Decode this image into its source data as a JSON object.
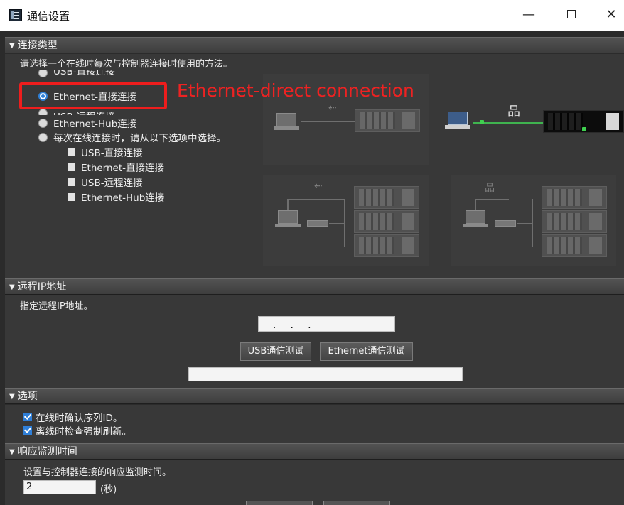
{
  "window": {
    "title": "通信设置",
    "minimize_glyph": "—",
    "close_glyph": "✕"
  },
  "connection_type": {
    "header": "连接类型",
    "description": "请选择一个在线时每次与控制器连接时使用的方法。",
    "options": [
      {
        "label": "USB-直接连接",
        "selected": false
      },
      {
        "label": "Ethernet-直接连接",
        "selected": true
      },
      {
        "label": "USB-远程连接",
        "selected": false
      },
      {
        "label": "Ethernet-Hub连接",
        "selected": false
      },
      {
        "label": "每次在线连接时，请从以下选项中选择。",
        "selected": false
      }
    ],
    "sub_options": [
      "USB-直接连接",
      "Ethernet-直接连接",
      "USB-远程连接",
      "Ethernet-Hub连接"
    ],
    "annotation": "Ethernet-direct connection",
    "annotation_color": "#ee2222"
  },
  "remote_ip": {
    "header": "远程IP地址",
    "description": "指定远程IP地址。",
    "ip_value": "__.__.__.__",
    "usb_test_button": "USB通信测试",
    "ethernet_test_button": "Ethernet通信测试",
    "result_value": ""
  },
  "options": {
    "header": "选项",
    "items": [
      {
        "label": "在线时确认序列ID。",
        "checked": true
      },
      {
        "label": "离线时检查强制刷新。",
        "checked": true
      }
    ]
  },
  "response_monitor": {
    "header": "响应监测时间",
    "description": "设置与控制器连接的响应监测时间。",
    "value": "2",
    "unit": "(秒)"
  },
  "colors": {
    "accent": "#2f7fd8",
    "link_line": "#3fb34f",
    "highlight": "#ee1d1d",
    "panel_bg": "#383838"
  },
  "icons": {
    "usb": "usb-icon",
    "network": "network-icon"
  }
}
